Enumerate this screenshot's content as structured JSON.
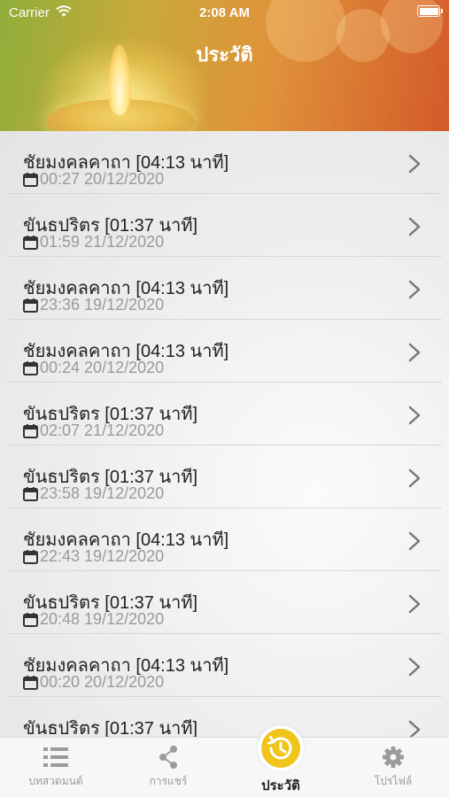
{
  "status_bar": {
    "carrier": "Carrier",
    "time": "2:08 AM"
  },
  "header": {
    "title": "ประวัติ"
  },
  "history": [
    {
      "title": "ชัยมงคลคาถา [04:13 นาที]",
      "datetime": "00:27 20/12/2020"
    },
    {
      "title": "ขันธปริตร [01:37 นาที]",
      "datetime": "01:59 21/12/2020"
    },
    {
      "title": "ชัยมงคลคาถา [04:13 นาที]",
      "datetime": "23:36 19/12/2020"
    },
    {
      "title": "ชัยมงคลคาถา [04:13 นาที]",
      "datetime": "00:24 20/12/2020"
    },
    {
      "title": "ขันธปริตร [01:37 นาที]",
      "datetime": "02:07 21/12/2020"
    },
    {
      "title": "ขันธปริตร [01:37 นาที]",
      "datetime": "23:58 19/12/2020"
    },
    {
      "title": "ชัยมงคลคาถา [04:13 นาที]",
      "datetime": "22:43 19/12/2020"
    },
    {
      "title": "ขันธปริตร [01:37 นาที]",
      "datetime": "20:48 19/12/2020"
    },
    {
      "title": "ชัยมงคลคาถา [04:13 นาที]",
      "datetime": "00:20 20/12/2020"
    },
    {
      "title": "ขันธปริตร [01:37 นาที]",
      "datetime": ""
    }
  ],
  "tabs": [
    {
      "label": "บทสวดมนต์",
      "icon": "list-icon"
    },
    {
      "label": "การแชร์",
      "icon": "share-icon"
    },
    {
      "label": "ประวัติ",
      "icon": "history-icon",
      "active": true
    },
    {
      "label": "โปรไฟล์",
      "icon": "gear-icon"
    }
  ],
  "colors": {
    "accent": "#f0c419",
    "header_start": "#8fae3a",
    "header_end": "#d45a2a",
    "inactive_tab": "#9b9b9b"
  }
}
